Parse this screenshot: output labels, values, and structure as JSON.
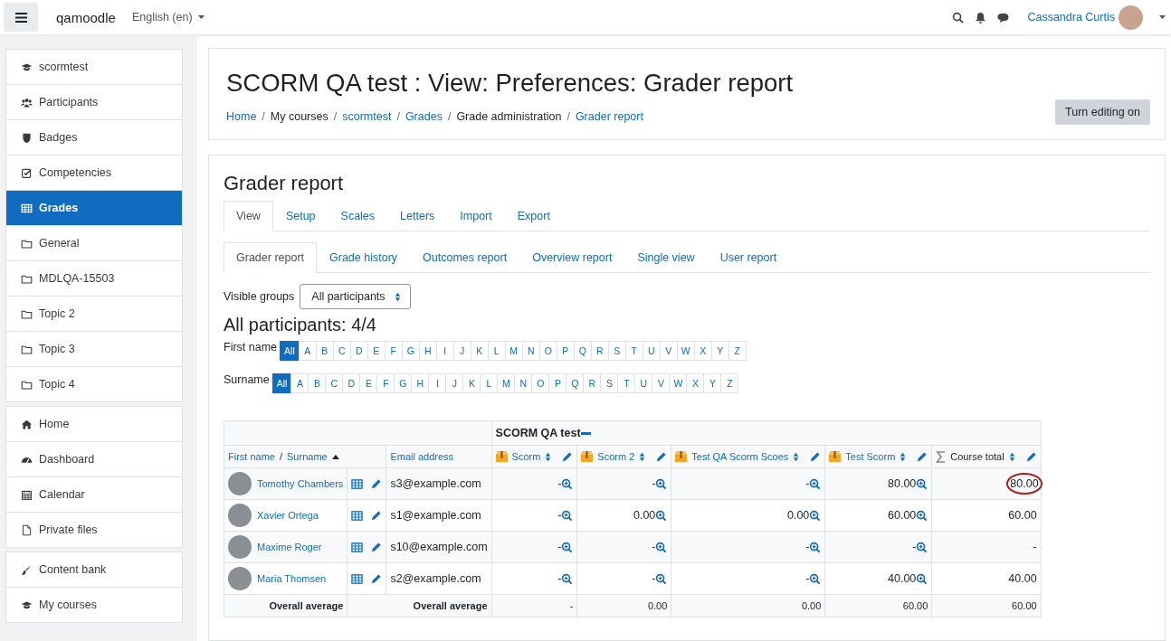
{
  "navbar": {
    "site_name": "qamoodle",
    "language": "English (en)",
    "user_name": "Cassandra Curtis"
  },
  "sidebar": {
    "groups": [
      [
        {
          "label": "scormtest",
          "kind": "course",
          "selected": false
        },
        {
          "label": "Participants",
          "kind": "participants",
          "selected": false
        },
        {
          "label": "Badges",
          "kind": "badges",
          "selected": false
        },
        {
          "label": "Competencies",
          "kind": "competencies",
          "selected": false
        },
        {
          "label": "Grades",
          "kind": "grades",
          "selected": true
        },
        {
          "label": "General",
          "kind": "section",
          "selected": false
        },
        {
          "label": "MDLQA-15503",
          "kind": "section",
          "selected": false
        },
        {
          "label": "Topic 2",
          "kind": "section",
          "selected": false
        },
        {
          "label": "Topic 3",
          "kind": "section",
          "selected": false
        },
        {
          "label": "Topic 4",
          "kind": "section",
          "selected": false
        }
      ],
      [
        {
          "label": "Home",
          "kind": "home",
          "selected": false
        },
        {
          "label": "Dashboard",
          "kind": "dashboard",
          "selected": false
        },
        {
          "label": "Calendar",
          "kind": "calendar",
          "selected": false
        },
        {
          "label": "Private files",
          "kind": "files",
          "selected": false
        }
      ],
      [
        {
          "label": "Content bank",
          "kind": "contentbank",
          "selected": false
        },
        {
          "label": "My courses",
          "kind": "course",
          "selected": false
        }
      ]
    ]
  },
  "header": {
    "title": "SCORM QA test : View: Preferences: Grader report",
    "separator": "/",
    "breadcrumb": [
      {
        "label": "Home",
        "link": true
      },
      {
        "label": "My courses",
        "link": false
      },
      {
        "label": "scormtest",
        "link": true
      },
      {
        "label": "Grades",
        "link": true
      },
      {
        "label": "Grade administration",
        "link": false
      },
      {
        "label": "Grader report",
        "link": true
      }
    ],
    "button": "Turn editing on"
  },
  "report": {
    "heading": "Grader report",
    "tabs": [
      {
        "label": "View",
        "selected": true
      },
      {
        "label": "Setup",
        "selected": false
      },
      {
        "label": "Scales",
        "selected": false
      },
      {
        "label": "Letters",
        "selected": false
      },
      {
        "label": "Import",
        "selected": false
      },
      {
        "label": "Export",
        "selected": false
      }
    ],
    "subtabs": [
      {
        "label": "Grader report",
        "selected": true
      },
      {
        "label": "Grade history",
        "selected": false
      },
      {
        "label": "Outcomes report",
        "selected": false
      },
      {
        "label": "Overview report",
        "selected": false
      },
      {
        "label": "Single view",
        "selected": false
      },
      {
        "label": "User report",
        "selected": false
      }
    ],
    "visible_groups": {
      "label": "Visible groups",
      "value": "All participants"
    },
    "participants_heading": "All participants: 4/4",
    "initial_bars": [
      {
        "label": "First name",
        "letters": [
          {
            "label": "All",
            "selected": true
          },
          {
            "label": "A",
            "selected": false
          },
          {
            "label": "B",
            "selected": false
          },
          {
            "label": "C",
            "selected": false
          },
          {
            "label": "D",
            "selected": false
          },
          {
            "label": "E",
            "selected": false
          },
          {
            "label": "F",
            "selected": false
          },
          {
            "label": "G",
            "selected": false
          },
          {
            "label": "H",
            "selected": false
          },
          {
            "label": "I",
            "selected": false
          },
          {
            "label": "J",
            "selected": false
          },
          {
            "label": "K",
            "selected": false
          },
          {
            "label": "L",
            "selected": false
          },
          {
            "label": "M",
            "selected": false
          },
          {
            "label": "N",
            "selected": false
          },
          {
            "label": "O",
            "selected": false
          },
          {
            "label": "P",
            "selected": false
          },
          {
            "label": "Q",
            "selected": false
          },
          {
            "label": "R",
            "selected": false
          },
          {
            "label": "S",
            "selected": false
          },
          {
            "label": "T",
            "selected": false
          },
          {
            "label": "U",
            "selected": false
          },
          {
            "label": "V",
            "selected": false
          },
          {
            "label": "W",
            "selected": false
          },
          {
            "label": "X",
            "selected": false
          },
          {
            "label": "Y",
            "selected": false
          },
          {
            "label": "Z",
            "selected": false
          }
        ]
      },
      {
        "label": "Surname",
        "letters": [
          {
            "label": "All",
            "selected": true
          },
          {
            "label": "A",
            "selected": false
          },
          {
            "label": "B",
            "selected": false
          },
          {
            "label": "C",
            "selected": false
          },
          {
            "label": "D",
            "selected": false
          },
          {
            "label": "E",
            "selected": false
          },
          {
            "label": "F",
            "selected": false
          },
          {
            "label": "G",
            "selected": false
          },
          {
            "label": "H",
            "selected": false
          },
          {
            "label": "I",
            "selected": false
          },
          {
            "label": "J",
            "selected": false
          },
          {
            "label": "K",
            "selected": false
          },
          {
            "label": "L",
            "selected": false
          },
          {
            "label": "M",
            "selected": false
          },
          {
            "label": "N",
            "selected": false
          },
          {
            "label": "O",
            "selected": false
          },
          {
            "label": "P",
            "selected": false
          },
          {
            "label": "Q",
            "selected": false
          },
          {
            "label": "R",
            "selected": false
          },
          {
            "label": "S",
            "selected": false
          },
          {
            "label": "T",
            "selected": false
          },
          {
            "label": "U",
            "selected": false
          },
          {
            "label": "V",
            "selected": false
          },
          {
            "label": "W",
            "selected": false
          },
          {
            "label": "X",
            "selected": false
          },
          {
            "label": "Y",
            "selected": false
          },
          {
            "label": "Z",
            "selected": false
          }
        ]
      }
    ],
    "table": {
      "category": "SCORM QA test",
      "name_header": {
        "first": "First name",
        "separator": "/",
        "last": "Surname"
      },
      "email_header": "Email address",
      "grade_columns": [
        {
          "label": "Scorm",
          "kind": "scorm"
        },
        {
          "label": "Scorm 2",
          "kind": "scorm"
        },
        {
          "label": "Test QA Scorm Scoes",
          "kind": "scorm"
        },
        {
          "label": "Test Scorm",
          "kind": "scorm"
        },
        {
          "label": "Course total",
          "kind": "total"
        }
      ],
      "rows": [
        {
          "name": "Tomothy Chambers",
          "email": "s3@example.com",
          "grades": [
            {
              "value": "-",
              "circled": false
            },
            {
              "value": "-",
              "circled": false
            },
            {
              "value": "-",
              "circled": false
            },
            {
              "value": "80.00",
              "circled": false
            },
            {
              "value": "80.00",
              "circled": true
            }
          ]
        },
        {
          "name": "Xavier Ortega",
          "email": "s1@example.com",
          "grades": [
            {
              "value": "-",
              "circled": false
            },
            {
              "value": "0.00",
              "circled": false
            },
            {
              "value": "0.00",
              "circled": false
            },
            {
              "value": "60.00",
              "circled": false
            },
            {
              "value": "60.00",
              "circled": false
            }
          ]
        },
        {
          "name": "Maxime Roger",
          "email": "s10@example.com",
          "grades": [
            {
              "value": "-",
              "circled": false
            },
            {
              "value": "-",
              "circled": false
            },
            {
              "value": "-",
              "circled": false
            },
            {
              "value": "-",
              "circled": false
            },
            {
              "value": "-",
              "circled": false
            }
          ]
        },
        {
          "name": "Maria Thomsen",
          "email": "s2@example.com",
          "grades": [
            {
              "value": "-",
              "circled": false
            },
            {
              "value": "-",
              "circled": false
            },
            {
              "value": "-",
              "circled": false
            },
            {
              "value": "40.00",
              "circled": false
            },
            {
              "value": "40.00",
              "circled": false
            }
          ]
        }
      ],
      "average": {
        "label": "Overall average",
        "label_2": "Overall average",
        "values": [
          "-",
          "0.00",
          "0.00",
          "60.00",
          "60.00"
        ]
      }
    }
  }
}
